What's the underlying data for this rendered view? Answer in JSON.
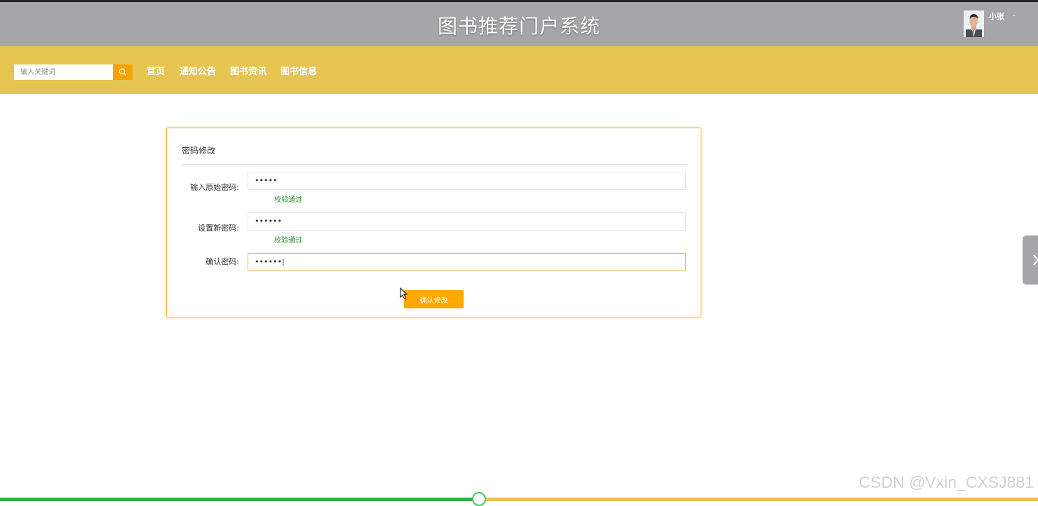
{
  "header": {
    "site_title": "图书推荐门户系统",
    "user_name": "小张",
    "user_caret": "-"
  },
  "navbar": {
    "search_placeholder": "输入关键词",
    "items": [
      {
        "label": "首页"
      },
      {
        "label": "通知公告"
      },
      {
        "label": "图书资讯"
      },
      {
        "label": "图书信息"
      }
    ]
  },
  "form": {
    "title": "密码修改",
    "fields": [
      {
        "label": "输入原始密码:",
        "value": "•••••",
        "tip": "校验通过"
      },
      {
        "label": "设置新密码:",
        "value": "••••••",
        "tip": "校验通过"
      },
      {
        "label": "确认密码:",
        "value": "••••••|",
        "tip": ""
      }
    ],
    "submit_label": "确认修改"
  },
  "video_progress": {
    "played_fraction": 0.462
  },
  "watermark": "CSDN @Vxin_CXSJ881",
  "colors": {
    "header_bg": "#a6a6a8",
    "navbar_bg": "#e6c452",
    "accent": "#ffa800",
    "success": "#2e8b2e"
  }
}
